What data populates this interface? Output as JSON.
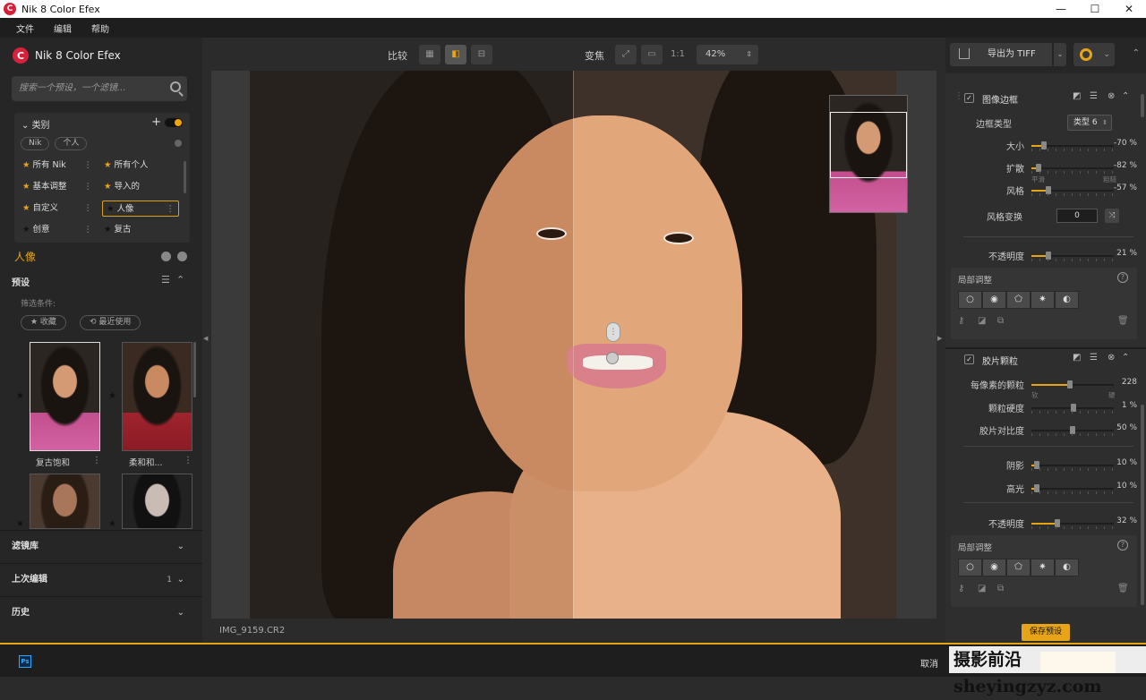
{
  "window": {
    "title": "Nik 8 Color Efex",
    "controls": [
      "—",
      "☐",
      "✕"
    ]
  },
  "menu": [
    "文件",
    "编辑",
    "帮助"
  ],
  "left": {
    "brand": "Nik 8 Color Efex",
    "search_placeholder": "搜索一个预设，一个滤镜...",
    "categories": {
      "title": "类别",
      "add": "+",
      "tags": [
        "Nik",
        "个人"
      ],
      "items": [
        {
          "label": "所有 Nik",
          "starred": true
        },
        {
          "label": "所有个人",
          "starred": true
        },
        {
          "label": "基本调整",
          "starred": true
        },
        {
          "label": "导入的",
          "starred": true
        },
        {
          "label": "自定义",
          "starred": true
        },
        {
          "label": "人像",
          "starred": false,
          "selected": true
        },
        {
          "label": "创意",
          "starred": false
        },
        {
          "label": "复古",
          "starred": false
        }
      ]
    },
    "section_title": "人像",
    "presets": {
      "title": "预设",
      "filter_label": "筛选条件:",
      "filters": [
        "★ 收藏",
        "⟲ 最近使用"
      ],
      "items": [
        {
          "name": "复古饱和",
          "style": "warm"
        },
        {
          "name": "柔和和...",
          "style": "red"
        },
        {
          "name": "",
          "style": "dark"
        },
        {
          "name": "",
          "style": "bw"
        }
      ]
    },
    "accordions": [
      {
        "label": "滤镜库",
        "count": ""
      },
      {
        "label": "上次编辑",
        "count": "1"
      },
      {
        "label": "历史",
        "count": ""
      }
    ]
  },
  "toolbar": {
    "compare_label": "比较",
    "zoom_label": "变焦",
    "one_to_one": "1:1",
    "zoom_value": "42%"
  },
  "status": {
    "filename": "IMG_9159.CR2"
  },
  "right": {
    "export_label": "导出为 TIFF",
    "filters": [
      {
        "name": "图像边框",
        "enabled": true,
        "border_type_label": "边框类型",
        "border_type_value": "类型 6",
        "sliders": [
          {
            "label": "大小",
            "value": "-70 %",
            "pos": 0.15
          },
          {
            "label": "扩散",
            "value": "-82 %",
            "pos": 0.09
          },
          {
            "label": "风格",
            "value": "-57 %",
            "pos": 0.21
          }
        ],
        "style_sub_left": "平滑",
        "style_sub_right": "粗糙",
        "variation_label": "风格变换",
        "variation_value": "0",
        "opacity": {
          "label": "不透明度",
          "value": "21 %",
          "pos": 0.21
        },
        "local_adjust": "局部调整"
      },
      {
        "name": "胶片颗粒",
        "enabled": true,
        "sliders": [
          {
            "label": "每像素的颗粒",
            "value": "228",
            "pos": 0.47
          },
          {
            "label": "颗粒硬度",
            "value": "1 %",
            "pos": 0.51
          },
          {
            "label": "胶片对比度",
            "value": "50 %",
            "pos": 0.5
          },
          {
            "label": "阴影",
            "value": "10 %",
            "pos": 0.07
          },
          {
            "label": "高光",
            "value": "10 %",
            "pos": 0.07
          }
        ],
        "grain_sub_left": "软",
        "grain_sub_right": "硬",
        "opacity": {
          "label": "不透明度",
          "value": "32 %",
          "pos": 0.32
        },
        "local_adjust": "局部调整"
      }
    ],
    "save_preset": "保存预设"
  },
  "bottom": {
    "ps_label": "Ps",
    "cancel": "取消",
    "watermark": "摄影前沿 sheyingzyz.com"
  },
  "colors": {
    "accent": "#e8a417",
    "brand": "#d6213a"
  }
}
